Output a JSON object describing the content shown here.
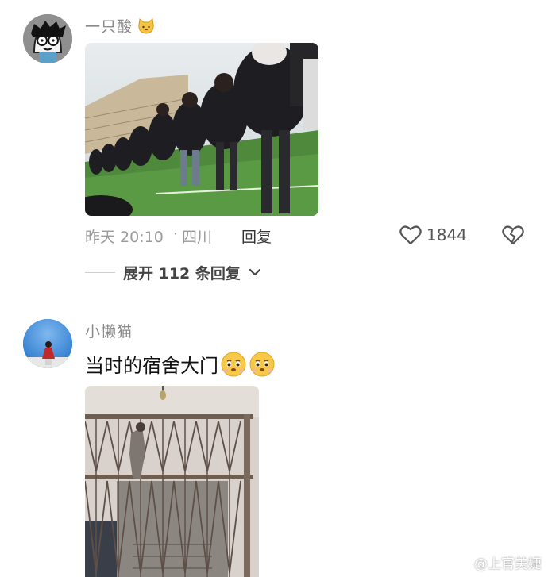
{
  "comments": [
    {
      "username": "一只酸",
      "username_emoji": "cat-emoji",
      "time": "昨天 20:10",
      "location": "四川",
      "reply_label": "回复",
      "likes": "1844",
      "expand_label": "展开 112 条回复"
    },
    {
      "username": "小懒猫",
      "text": "当时的宿舍大门",
      "text_emoji": "crying-face-emoji"
    }
  ],
  "separator": "·",
  "watermark": "@上官美婕",
  "colors": {
    "username": "#8a8a8a",
    "meta": "#9a9a9a",
    "text": "#111111"
  }
}
